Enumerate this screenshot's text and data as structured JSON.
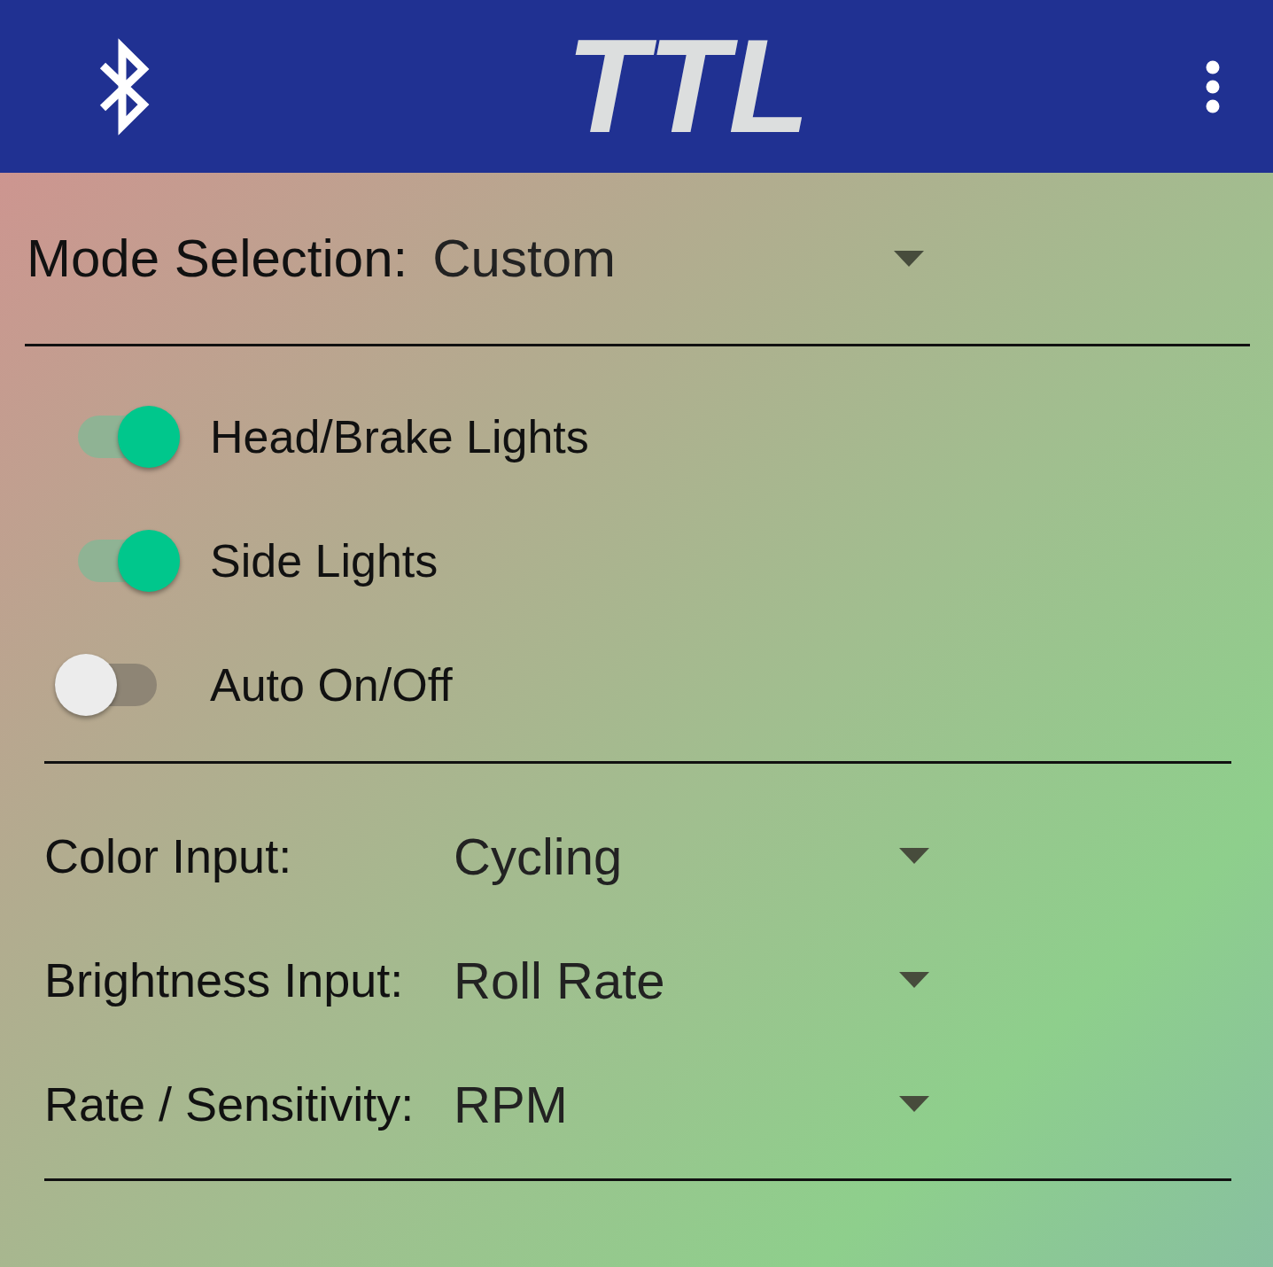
{
  "app_bar": {
    "logo": "TTL"
  },
  "mode_selection": {
    "label": "Mode Selection:",
    "value": "Custom"
  },
  "toggles": [
    {
      "label": "Head/Brake Lights",
      "on": true
    },
    {
      "label": "Side Lights",
      "on": true
    },
    {
      "label": "Auto On/Off",
      "on": false
    }
  ],
  "inputs": [
    {
      "label": "Color Input:",
      "value": "Cycling"
    },
    {
      "label": "Brightness Input:",
      "value": "Roll Rate"
    },
    {
      "label": "Rate / Sensitivity:",
      "value": "RPM"
    }
  ]
}
